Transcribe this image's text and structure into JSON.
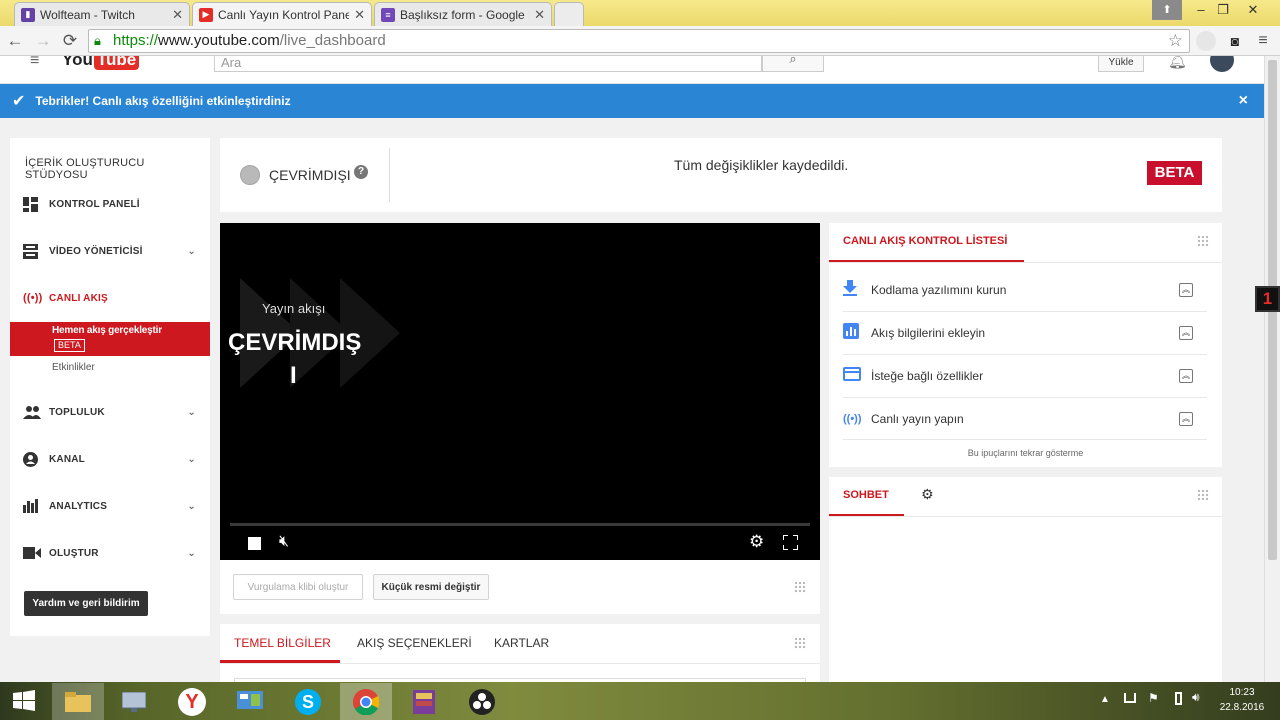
{
  "browser": {
    "tabs": [
      {
        "label": "Wolfteam - Twitch",
        "icon": "twitch-icon",
        "color": "#6441a4"
      },
      {
        "label": "Canlı Yayın Kontrol Paneli",
        "icon": "youtube-icon",
        "color": "#e52d27"
      },
      {
        "label": "Başlıksız form - Google Fo",
        "icon": "google-forms-icon",
        "color": "#7248b9"
      }
    ],
    "close_glyph": "✕",
    "url_scheme": "https://",
    "url_host": "www.youtube.com",
    "url_path": "/live_dashboard"
  },
  "header": {
    "logo": "You Tube",
    "search_placeholder": "Ara",
    "upload_label": "Yükle"
  },
  "banner": {
    "message": "Tebrikler! Canlı akış özelliğini etkinleştirdiniz",
    "close": "×"
  },
  "sidebar": {
    "title": "İÇERİK OLUŞTURUCU STÜDYOSU",
    "items": [
      {
        "label": "KONTROL PANELİ",
        "icon": "dashboard-icon"
      },
      {
        "label": "VİDEO YÖNETİCİSİ",
        "icon": "video-manager-icon"
      },
      {
        "label": "CANLI AKIŞ",
        "icon": "live-stream-icon"
      },
      {
        "label": "TOPLULUK",
        "icon": "community-icon"
      },
      {
        "label": "KANAL",
        "icon": "channel-icon"
      },
      {
        "label": "ANALYTICS",
        "icon": "analytics-icon"
      },
      {
        "label": "OLUŞTUR",
        "icon": "create-icon"
      }
    ],
    "sub_active": "Hemen akış gerçekleştir",
    "sub_badge": "BETA",
    "sub_events": "Etkinlikler",
    "help_button": "Yardım ve geri bildirim"
  },
  "status": {
    "state": "ÇEVRİMDIŞI",
    "saved_message": "Tüm değişiklikler kaydedildi.",
    "beta": "BETA"
  },
  "player": {
    "overlay_title": "Yayın akışı",
    "overlay_state_line1": "ÇEVRİMDIŞ",
    "overlay_state_line2": "I"
  },
  "actions": {
    "highlight_clip": "Vurgulama klibi oluştur",
    "change_thumbnail": "Küçük resmi değiştir"
  },
  "bottom_tabs": [
    "TEMEL BİLGİLER",
    "AKIŞ SEÇENEKLERİ",
    "KARTLAR"
  ],
  "checklist": {
    "title": "CANLI AKIŞ KONTROL LİSTESİ",
    "items": [
      {
        "label": "Kodlama yazılımını kurun",
        "icon": "download-icon"
      },
      {
        "label": "Akış bilgilerini ekleyin",
        "icon": "stats-icon"
      },
      {
        "label": "İsteğe bağlı özellikler",
        "icon": "card-icon"
      },
      {
        "label": "Canlı yayın yapın",
        "icon": "broadcast-icon"
      }
    ],
    "hide_tips": "Bu ipuçlarını tekrar gösterme"
  },
  "chat": {
    "title": "SOHBET"
  },
  "taskbar": {
    "time": "10:23",
    "date": "22.8.2016"
  },
  "side_badge": "1",
  "colors": {
    "accent": "#cc181e",
    "banner": "#2a86d5",
    "beta": "#c8102e"
  }
}
